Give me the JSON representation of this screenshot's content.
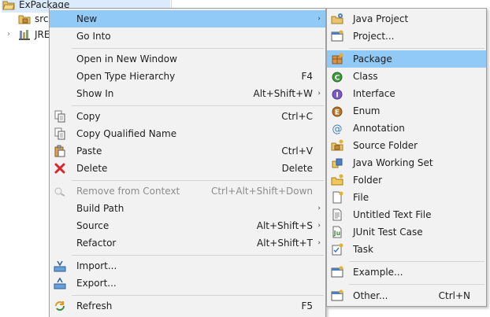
{
  "tree": {
    "project": "ExPackage",
    "src": "src",
    "jre": "JRE"
  },
  "main_menu": {
    "new": "New",
    "go_into": "Go Into",
    "open_new_window": "Open in New Window",
    "open_type_hierarchy": "Open Type Hierarchy",
    "open_type_hierarchy_sc": "F4",
    "show_in": "Show In",
    "show_in_sc": "Alt+Shift+W",
    "copy": "Copy",
    "copy_sc": "Ctrl+C",
    "copy_qualified": "Copy Qualified Name",
    "paste": "Paste",
    "paste_sc": "Ctrl+V",
    "delete": "Delete",
    "delete_sc": "Delete",
    "remove_context": "Remove from Context",
    "remove_context_sc": "Ctrl+Alt+Shift+Down",
    "build_path": "Build Path",
    "source": "Source",
    "source_sc": "Alt+Shift+S",
    "refactor": "Refactor",
    "refactor_sc": "Alt+Shift+T",
    "import": "Import...",
    "export": "Export...",
    "refresh": "Refresh",
    "refresh_sc": "F5"
  },
  "sub_menu": {
    "java_project": "Java Project",
    "project": "Project...",
    "package": "Package",
    "class": "Class",
    "interface": "Interface",
    "enum": "Enum",
    "annotation": "Annotation",
    "source_folder": "Source Folder",
    "java_working_set": "Java Working Set",
    "folder": "Folder",
    "file": "File",
    "untitled_text_file": "Untitled Text File",
    "junit_test_case": "JUnit Test Case",
    "task": "Task",
    "example": "Example...",
    "other": "Other...",
    "other_sc": "Ctrl+N"
  },
  "colors": {
    "highlight": "#91c9f7",
    "menu_bg": "#f2f2f2",
    "tree_selection": "#dcebfc"
  },
  "icons": {
    "arrow": "›",
    "twisty": "›"
  }
}
